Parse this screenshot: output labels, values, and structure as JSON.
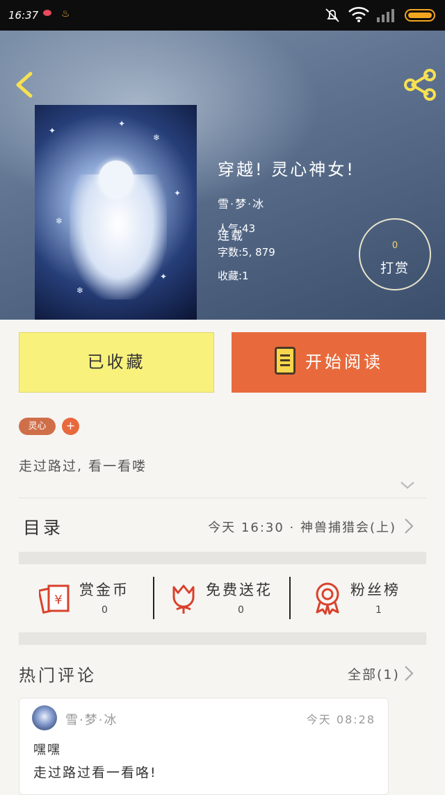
{
  "status_bar": {
    "time": "16:37"
  },
  "book": {
    "title": "穿越! 灵心神女!",
    "author": "雪·梦·冰",
    "status": "连载",
    "popularity": "人气:43",
    "word_count": "字数:5, 879",
    "favorites": "收藏:1"
  },
  "reward": {
    "count": "0",
    "label": "打赏"
  },
  "buttons": {
    "favorited": "已收藏",
    "start_reading": "开始阅读"
  },
  "tags": {
    "items": [
      "灵心"
    ],
    "add": "+"
  },
  "description": "走过路过, 看一看喽",
  "toc": {
    "label": "目录",
    "latest": "今天 16:30 · 神兽捕猎会(上)"
  },
  "actions": [
    {
      "name": "赏金币",
      "count": "0",
      "icon": "red-envelope-icon"
    },
    {
      "name": "免费送花",
      "count": "0",
      "icon": "flower-icon"
    },
    {
      "name": "粉丝榜",
      "count": "1",
      "icon": "medal-icon"
    }
  ],
  "hot_comments": {
    "title": "热门评论",
    "all_label": "全部(1)",
    "items": [
      {
        "user": "雪·梦·冰",
        "time": "今天 08:28",
        "line1": "嘿嘿",
        "line2": "走过路过看一看咯!"
      }
    ]
  },
  "colors": {
    "accent": "#e86a3c",
    "favorite_button": "#f8f17c",
    "icon_red": "#d9412c"
  }
}
